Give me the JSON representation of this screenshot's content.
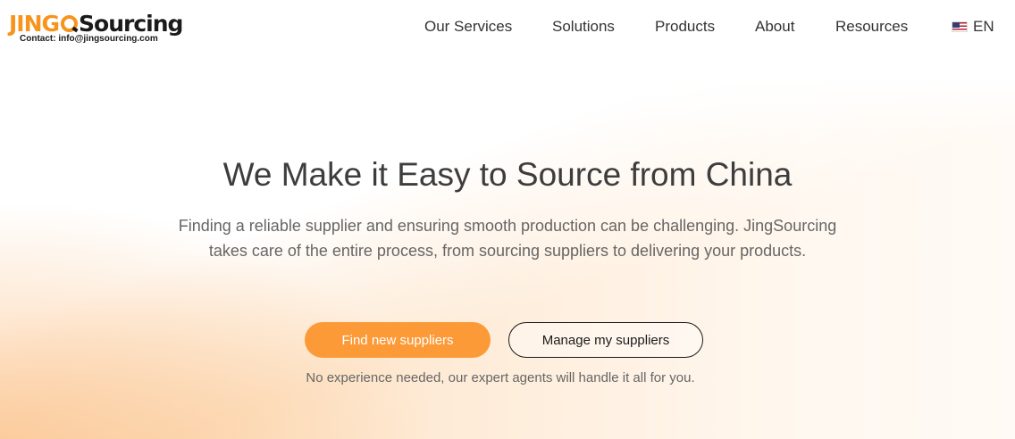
{
  "logo": {
    "part1": "JING",
    "part2": "Sourcing",
    "contact": "Contact: info@jingsourcing.com"
  },
  "nav": {
    "items": [
      {
        "label": "Our Services"
      },
      {
        "label": "Solutions"
      },
      {
        "label": "Products"
      },
      {
        "label": "About"
      },
      {
        "label": "Resources"
      }
    ],
    "language": "EN",
    "language_icon": "us-flag-icon"
  },
  "hero": {
    "title": "We Make it Easy to Source from China",
    "description": "Finding a reliable supplier and ensuring smooth production can be challenging. JingSourcing takes care of the entire process, from sourcing suppliers to delivering your products.",
    "primary_button": "Find new suppliers",
    "secondary_button": "Manage my suppliers",
    "note": "No experience needed, our expert agents will handle it all for you."
  },
  "colors": {
    "accent": "#fd9a38",
    "brand_orange": "#f7941d",
    "text_dark": "#3d3d3d",
    "text_muted": "#666666"
  }
}
